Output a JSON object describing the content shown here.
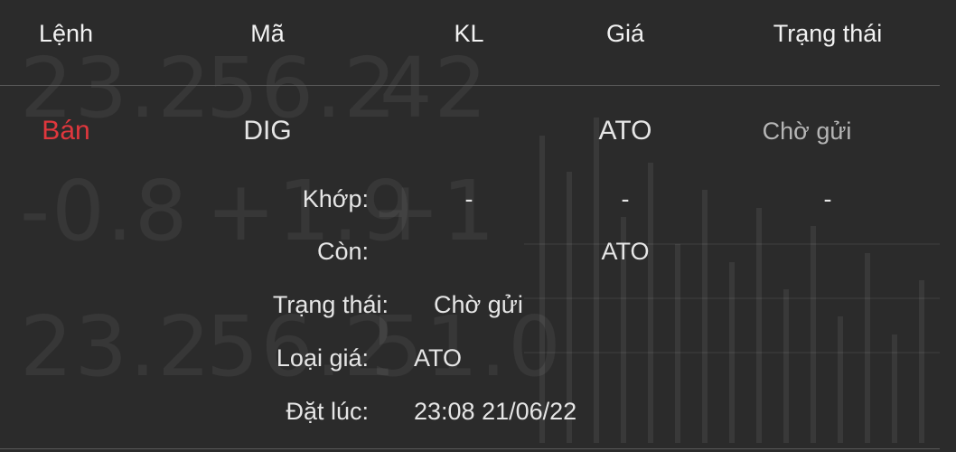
{
  "background": {
    "ticker_numbers": [
      "23.2",
      "56.2",
      "42",
      "-0.8",
      "+1.9",
      "+1",
      "23.2",
      "56.2",
      "51.0"
    ]
  },
  "header": {
    "col_order": "Lệnh",
    "col_symbol": "Mã",
    "col_qty": "KL",
    "col_price": "Giá",
    "col_status": "Trạng thái"
  },
  "order": {
    "side": "Bán",
    "symbol": "DIG",
    "price": "ATO",
    "status": "Chờ gửi"
  },
  "details": {
    "matched_label": "Khớp:",
    "matched_qty": "-",
    "matched_price": "-",
    "matched_status": "-",
    "remaining_label": "Còn:",
    "remaining_price": "ATO",
    "status_label": "Trạng thái:",
    "status_value": "Chờ gửi",
    "price_type_label": "Loại giá:",
    "price_type_value": "ATO",
    "placed_at_label": "Đặt lúc:",
    "placed_at_value": "23:08 21/06/22"
  },
  "colors": {
    "background": "#2b2b2b",
    "sell": "#e0373d",
    "text": "#e6e6e6",
    "muted": "#b5b5b5",
    "divider": "#5a5a5a"
  }
}
